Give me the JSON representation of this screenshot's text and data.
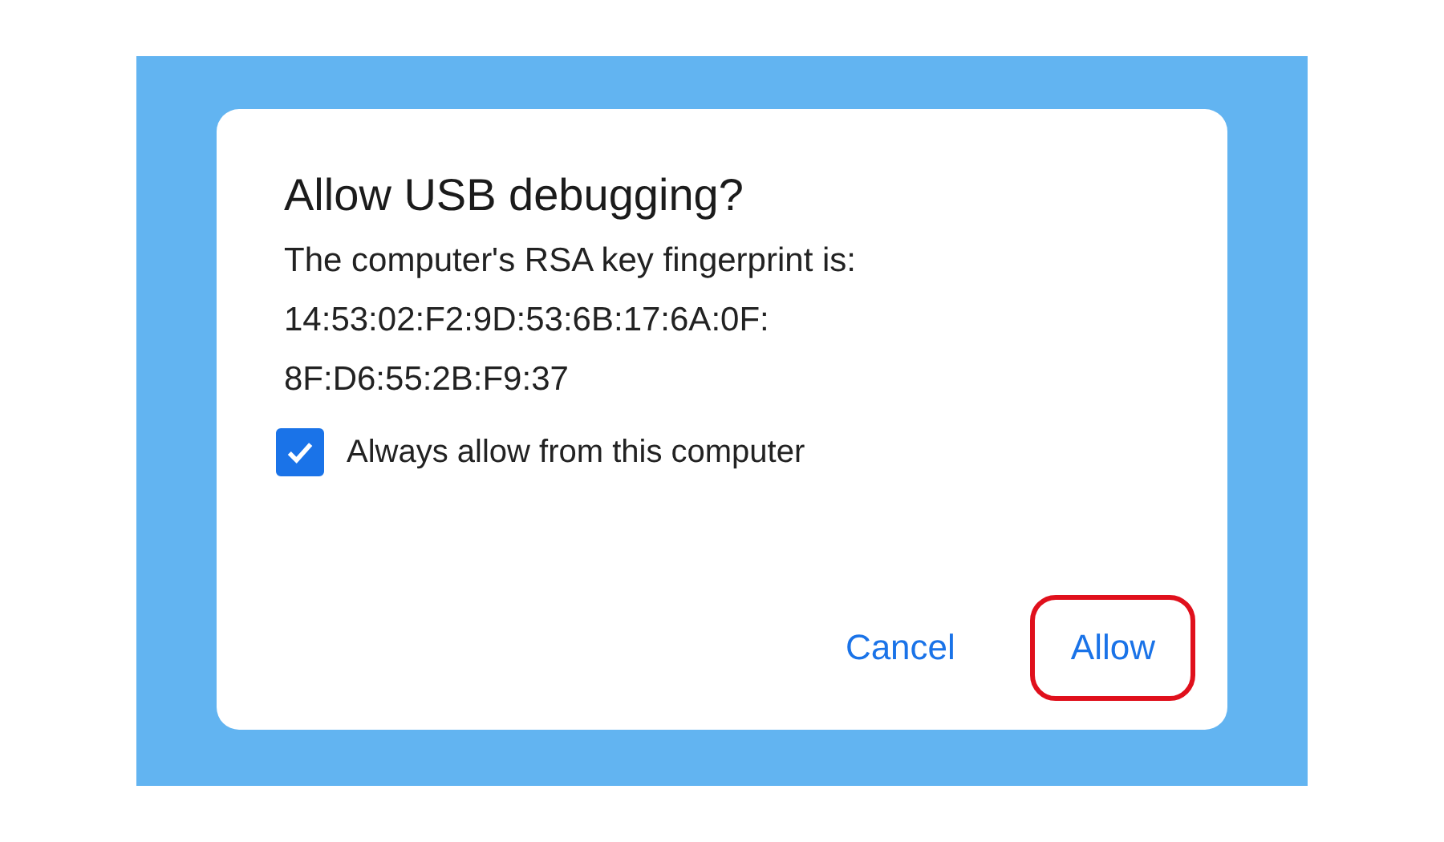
{
  "dialog": {
    "title": "Allow USB debugging?",
    "message": "The computer's RSA key fingerprint is:",
    "fingerprint_lines": [
      "14:53:02:F2:9D:53:6B:17:6A:0F:",
      "8F:D6:55:2B:F9:37"
    ],
    "checkbox": {
      "label": "Always allow from this computer",
      "checked": true
    },
    "buttons": [
      {
        "label": "Cancel",
        "highlighted": false
      },
      {
        "label": "Allow",
        "highlighted": true
      }
    ]
  }
}
